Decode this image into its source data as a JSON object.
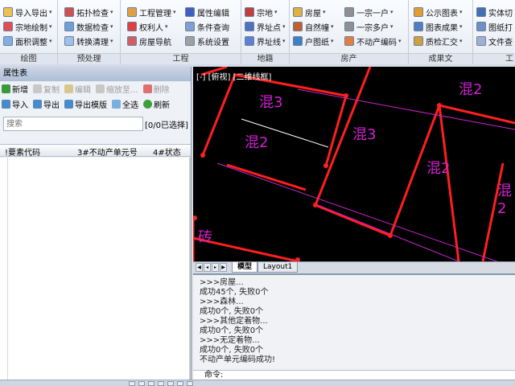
{
  "ribbon": {
    "groups": [
      {
        "label": "绘图",
        "items": [
          "导入导出",
          "宗地绘制",
          "面积调整"
        ]
      },
      {
        "label": "预处理",
        "items": [
          "拓扑检查",
          "数据检查",
          "转换清理"
        ]
      },
      {
        "label": "工程",
        "items": [
          "工程管理",
          "权利人",
          "房屋导航",
          "属性编辑",
          "条件查询",
          "系统设置"
        ]
      },
      {
        "label": "地籍",
        "items": [
          "宗地",
          "界址点",
          "界址线"
        ]
      },
      {
        "label": "房产",
        "items": [
          "房屋",
          "自然幢",
          "户图纸",
          "一宗一户",
          "一宗多户",
          "不动产编码"
        ]
      },
      {
        "label": "成果文",
        "items": [
          "公示图表",
          "图表成果",
          "质检汇交"
        ]
      },
      {
        "label": "工",
        "items": [
          "实体切",
          "图纸打",
          "文件查"
        ]
      }
    ]
  },
  "panel": {
    "title": "属性表",
    "toolbar1": [
      "新增",
      "复制",
      "编辑",
      "缩放至...",
      "删除"
    ],
    "toolbar2": [
      "导入",
      "导出",
      "导出模版",
      "全选",
      "刷新"
    ],
    "search_placeholder": "搜索",
    "selection_count": "[0/0已选择]",
    "columns": [
      "!要素代码",
      "3#不动产单元号",
      "4#状态"
    ]
  },
  "cad": {
    "view_label": "[-] [俯视] [二维线框]",
    "labels": [
      "混3",
      "混2",
      "混3",
      "混2",
      "混2",
      "混2",
      "砖"
    ],
    "colors": {
      "parcel_line": "#ff1f1f",
      "boundary": "#cc22cc",
      "label": "#d020d0",
      "background": "#000000"
    }
  },
  "tabs": {
    "model": "模型",
    "layout": "Layout1"
  },
  "command": {
    "lines": [
      ">>>房屋...",
      "成功45个, 失败0个",
      ">>>森林...",
      "成功0个, 失败0个",
      ">>>其他定着物...",
      "成功0个, 失败0个",
      ">>>无定着物...",
      "成功0个, 失败0个",
      "不动产单元编码成功!"
    ],
    "prompt": "命令:"
  }
}
